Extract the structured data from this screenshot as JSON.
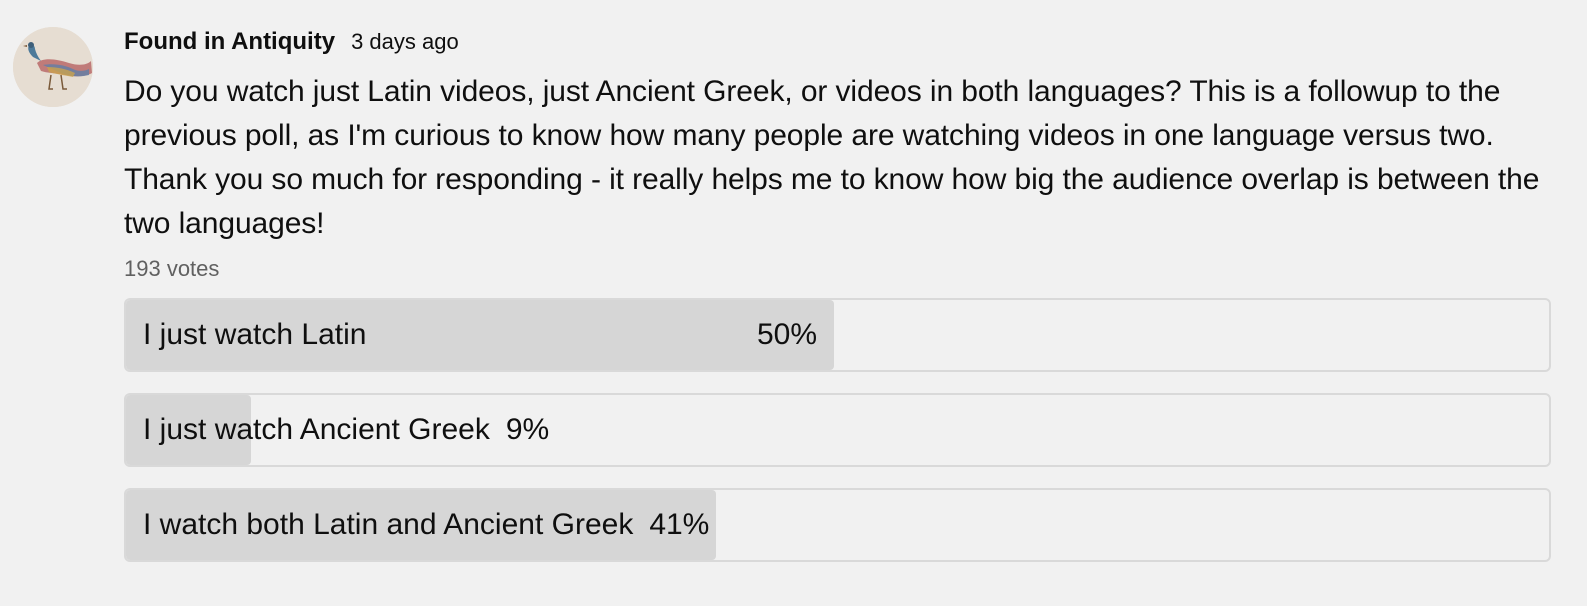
{
  "post": {
    "author": "Found in Antiquity",
    "time": "3 days ago",
    "text": "Do you watch just Latin videos, just Ancient Greek, or videos in both languages? This is a followup to the previous poll, as I'm curious to know how many people are watching videos in one language versus two. Thank you so much for responding - it really helps me to know how big the audience overlap is between the two languages!",
    "avatar_icon": "peacock-avatar-icon"
  },
  "poll": {
    "votes": "193 votes",
    "options": [
      {
        "label": "I just watch Latin",
        "percent": "50%",
        "fraction": 0.5
      },
      {
        "label": "I just watch Ancient Greek",
        "percent": "9%",
        "fraction": 0.09
      },
      {
        "label": "I watch both Latin and Ancient Greek",
        "percent": "41%",
        "fraction": 0.41
      }
    ],
    "fill_color": "#d6d6d6",
    "border_color": "#d9d9d9"
  }
}
